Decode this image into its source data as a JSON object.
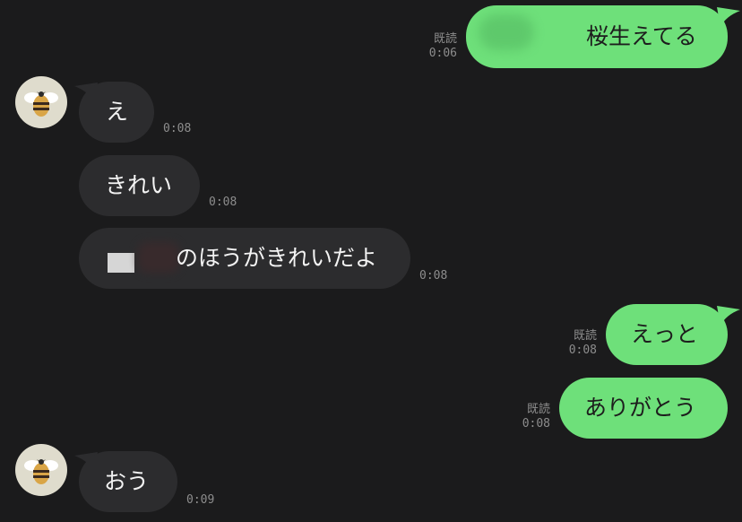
{
  "messages": [
    {
      "side": "out",
      "text": "桜生えてる",
      "read": "既読",
      "time": "0:06"
    },
    {
      "side": "in",
      "text": "え",
      "time": "0:08",
      "avatar": "bee-avatar"
    },
    {
      "side": "in",
      "text": "きれい",
      "time": "0:08"
    },
    {
      "side": "in",
      "text": "のほうがきれいだよ",
      "time": "0:08",
      "redacted_prefix": true
    },
    {
      "side": "out",
      "text": "えっと",
      "read": "既読",
      "time": "0:08"
    },
    {
      "side": "out",
      "text": "ありがとう",
      "read": "既読",
      "time": "0:08"
    },
    {
      "side": "in",
      "text": "おう",
      "time": "0:09",
      "avatar": "bee-avatar"
    }
  ],
  "colors": {
    "background": "#1b1b1c",
    "incoming_bubble": "#2c2c2e",
    "outgoing_bubble": "#6ee07a",
    "meta_text": "#8d8d8d"
  }
}
